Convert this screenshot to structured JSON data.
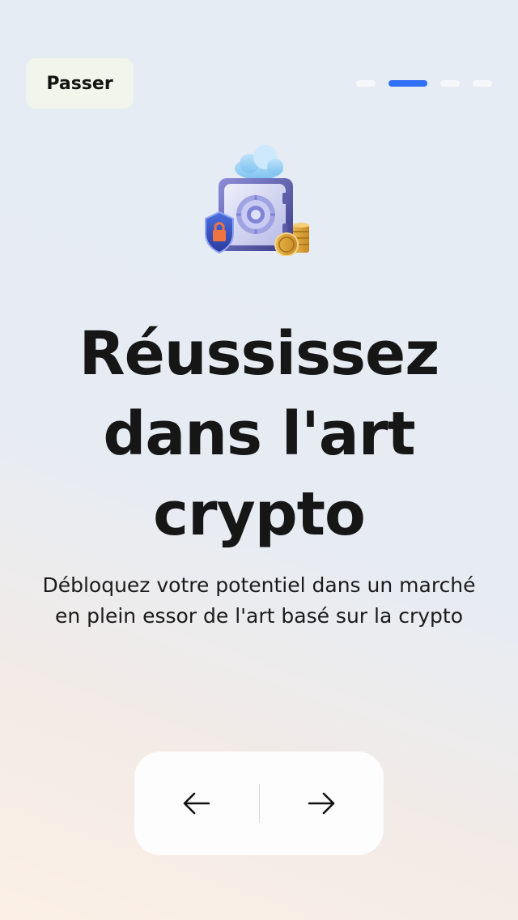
{
  "header": {
    "skip_label": "Passer",
    "pager": {
      "total": 4,
      "active_index": 1
    }
  },
  "hero": {
    "icon": "safe-vault-icon"
  },
  "content": {
    "title_lines": [
      "Réussissez",
      "dans l'art",
      "crypto"
    ],
    "subtitle_lines": [
      "Débloquez votre potentiel dans un marché",
      "en plein essor de l'art basé sur la crypto"
    ]
  },
  "navigation": {
    "back_icon": "arrow-left-icon",
    "next_icon": "arrow-right-icon"
  },
  "colors": {
    "accent": "#2f6ff5",
    "skip_bg": "#f1f5ec",
    "text": "#161616"
  }
}
